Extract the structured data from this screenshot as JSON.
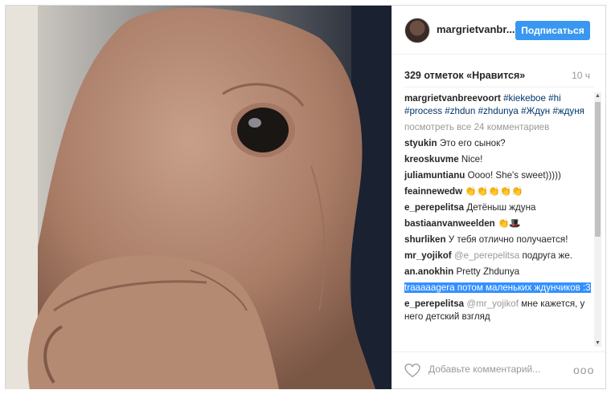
{
  "post": {
    "username": "margrietvanbr...",
    "follow_label": "Подписаться",
    "likes": "329 отметок «Нравится»",
    "time": "10 ч"
  },
  "caption": {
    "username": "margrietvanbreevoort",
    "tags": [
      "#kiekeboe",
      "#hi",
      "#process",
      "#zhdun",
      "#zhdunya",
      "#Ждун",
      "#ждуня"
    ]
  },
  "view_all": "посмотреть все 24 комментариев",
  "comments": [
    {
      "user": "styukin",
      "text": "Это его сынок?"
    },
    {
      "user": "kreoskuvme",
      "text": "Nice!"
    },
    {
      "user": "juliamuntianu",
      "text": "Oooo! She's sweet)))))"
    },
    {
      "user": "feainnewedw",
      "text": "👏👏👏👏👏"
    },
    {
      "user": "e_perepelitsa",
      "text": "Детёныш ждуна"
    },
    {
      "user": "bastiaanvanweelden",
      "text": "👏🎩"
    },
    {
      "user": "shurliken",
      "text": "У тебя отлично получается!"
    },
    {
      "user": "mr_yojikof",
      "mention": "@e_perepelitsa",
      "text": "подруга же."
    },
    {
      "user": "an.anokhin",
      "text": "Pretty Zhdunya"
    },
    {
      "user": "traaaaager",
      "text": "а потом маленьких ждунчиков :3"
    },
    {
      "user": "e_perepelitsa",
      "mention": "@mr_yojikof",
      "text": "мне кажется, у него детский взгляд"
    }
  ],
  "footer": {
    "add_comment_placeholder": "Добавьте комментарий...",
    "more_label": "ooo"
  },
  "colors": {
    "accent": "#3897f0",
    "selection": "#3390ff",
    "hashtag": "#003569"
  },
  "icons": {
    "heart": "heart-outline-icon",
    "more": "more-options-icon"
  }
}
